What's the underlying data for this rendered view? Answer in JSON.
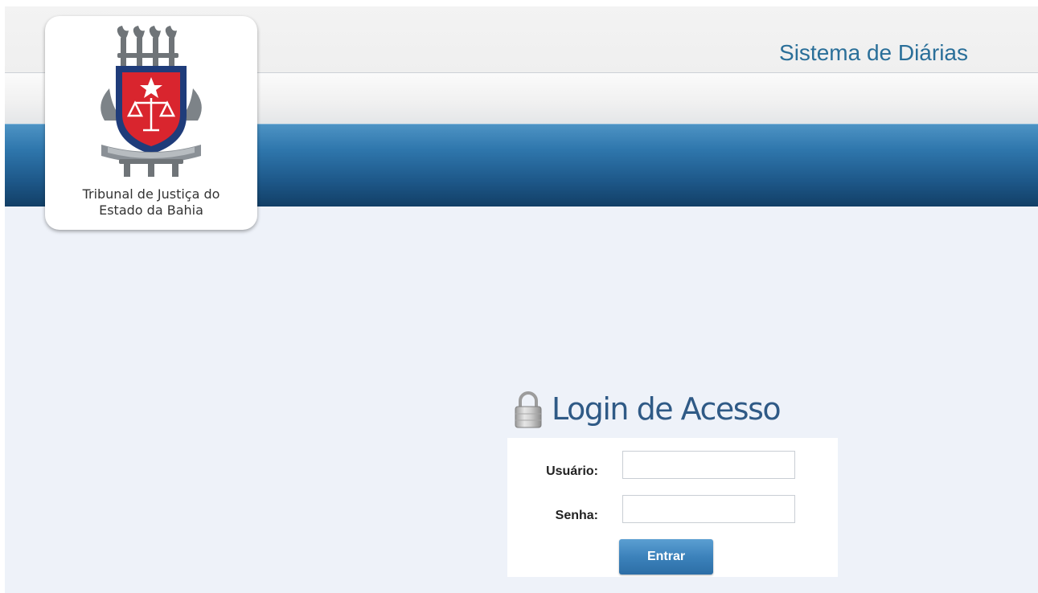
{
  "header": {
    "system_title": "Sistema de Diárias"
  },
  "logo": {
    "icon": "court-crest-icon",
    "caption_line1": "Tribunal de Justiça do",
    "caption_line2": "Estado da Bahia"
  },
  "login": {
    "icon": "lock-icon",
    "title": "Login de Acesso",
    "username_label": "Usuário:",
    "username_value": "",
    "password_label": "Senha:",
    "password_value": "",
    "submit_label": "Entrar"
  },
  "colors": {
    "title_blue": "#2a6f99",
    "band_blue": "#1d5788",
    "button_blue": "#3c82bb",
    "page_background": "#eef2f9"
  }
}
